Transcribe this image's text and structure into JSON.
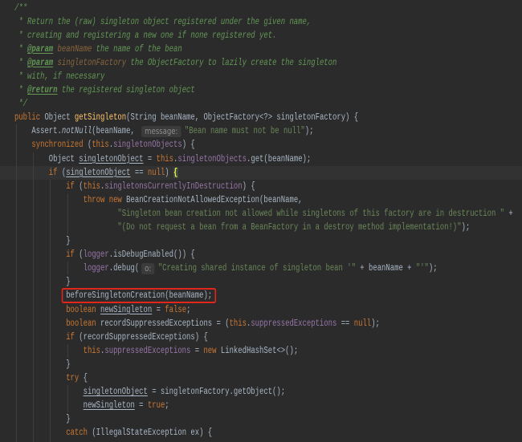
{
  "colors": {
    "background": "#2B2B2B",
    "text": "#A9B7C6",
    "current_line": "#323232",
    "indent_guide": "#3E3E3E",
    "annotation_box": "#E3261C",
    "hint_text": "#8E8E8E",
    "hint_background": "#3B3B3B"
  },
  "editor": {
    "lines": [
      {
        "tokens": [
          {
            "t": "/**",
            "c": "#629755",
            "i": true
          }
        ]
      },
      {
        "tokens": [
          {
            "t": " * Return the (raw) singleton object registered under the given name,",
            "c": "#629755",
            "i": true
          }
        ]
      },
      {
        "tokens": [
          {
            "t": " * creating and registering a new one if none registered yet.",
            "c": "#629755",
            "i": true
          }
        ]
      },
      {
        "tokens": [
          {
            "t": " * ",
            "c": "#629755",
            "i": true
          },
          {
            "t": "@param",
            "c": "#629755",
            "i": true,
            "b": true,
            "u": true
          },
          {
            "t": " ",
            "c": "#629755",
            "i": true
          },
          {
            "t": "beanName",
            "c": "#8A653B",
            "i": true
          },
          {
            "t": " the name of the bean",
            "c": "#629755",
            "i": true
          }
        ]
      },
      {
        "tokens": [
          {
            "t": " * ",
            "c": "#629755",
            "i": true
          },
          {
            "t": "@param",
            "c": "#629755",
            "i": true,
            "b": true,
            "u": true
          },
          {
            "t": " ",
            "c": "#629755",
            "i": true
          },
          {
            "t": "singletonFactory",
            "c": "#8A653B",
            "i": true
          },
          {
            "t": " the ObjectFactory to lazily create the singleton",
            "c": "#629755",
            "i": true
          }
        ]
      },
      {
        "tokens": [
          {
            "t": " * with, if necessary",
            "c": "#629755",
            "i": true
          }
        ]
      },
      {
        "tokens": [
          {
            "t": " * ",
            "c": "#629755",
            "i": true
          },
          {
            "t": "@return",
            "c": "#629755",
            "i": true,
            "b": true,
            "u": true
          },
          {
            "t": " the registered singleton object",
            "c": "#629755",
            "i": true
          }
        ]
      },
      {
        "tokens": [
          {
            "t": " */",
            "c": "#629755",
            "i": true
          }
        ]
      },
      {
        "tokens": [
          {
            "t": "public",
            "c": "#CC7832"
          },
          {
            "t": " Object "
          },
          {
            "t": "getSingleton",
            "c": "#FFC66D"
          },
          {
            "t": "(String beanName, ObjectFactory<?> singletonFactory) {"
          }
        ]
      },
      {
        "tokens": [
          {
            "t": "    Assert."
          },
          {
            "t": "notNull",
            "i": true
          },
          {
            "t": "(beanName, "
          },
          {
            "t": "message:",
            "hint": true
          },
          {
            "t": "\"Bean name must not be null\"",
            "c": "#6A8759"
          },
          {
            "t": ");"
          }
        ]
      },
      {
        "tokens": [
          {
            "t": "    "
          },
          {
            "t": "synchronized",
            "c": "#CC7832"
          },
          {
            "t": " ("
          },
          {
            "t": "this",
            "c": "#CC7832"
          },
          {
            "t": "."
          },
          {
            "t": "singletonObjects",
            "c": "#9876AA"
          },
          {
            "t": ") {"
          }
        ]
      },
      {
        "tokens": [
          {
            "t": "        Object "
          },
          {
            "t": "singletonObject",
            "u": true
          },
          {
            "t": " = "
          },
          {
            "t": "this",
            "c": "#CC7832"
          },
          {
            "t": "."
          },
          {
            "t": "singletonObjects",
            "c": "#9876AA"
          },
          {
            "t": ".get(beanName);"
          }
        ]
      },
      {
        "current": true,
        "tokens": [
          {
            "t": "        "
          },
          {
            "t": "if",
            "c": "#CC7832"
          },
          {
            "t": " ("
          },
          {
            "t": "singletonObject",
            "u": true
          },
          {
            "t": " == "
          },
          {
            "t": "null",
            "c": "#CC7832"
          },
          {
            "t": ") "
          },
          {
            "t": "{",
            "c": "#FFEF28",
            "b": true,
            "bg": "#3B514D"
          }
        ]
      },
      {
        "tokens": [
          {
            "t": "            "
          },
          {
            "t": "if",
            "c": "#CC7832"
          },
          {
            "t": " ("
          },
          {
            "t": "this",
            "c": "#CC7832"
          },
          {
            "t": "."
          },
          {
            "t": "singletonsCurrentlyInDestruction",
            "c": "#9876AA"
          },
          {
            "t": ") {"
          }
        ]
      },
      {
        "tokens": [
          {
            "t": "                "
          },
          {
            "t": "throw",
            "c": "#CC7832"
          },
          {
            "t": " "
          },
          {
            "t": "new",
            "c": "#CC7832"
          },
          {
            "t": " BeanCreationNotAllowedException(beanName,"
          }
        ]
      },
      {
        "tokens": [
          {
            "t": "                        "
          },
          {
            "t": "\"Singleton bean creation not allowed while singletons of this factory are in destruction \"",
            "c": "#6A8759"
          },
          {
            "t": " +"
          }
        ]
      },
      {
        "tokens": [
          {
            "t": "                        "
          },
          {
            "t": "\"(Do not request a bean from a BeanFactory in a destroy method implementation!)\"",
            "c": "#6A8759"
          },
          {
            "t": ");"
          }
        ]
      },
      {
        "tokens": [
          {
            "t": "            }"
          }
        ]
      },
      {
        "tokens": [
          {
            "t": "            "
          },
          {
            "t": "if",
            "c": "#CC7832"
          },
          {
            "t": " ("
          },
          {
            "t": "logger",
            "c": "#9876AA"
          },
          {
            "t": ".isDebugEnabled()) {"
          }
        ]
      },
      {
        "tokens": [
          {
            "t": "                "
          },
          {
            "t": "logger",
            "c": "#9876AA"
          },
          {
            "t": ".debug("
          },
          {
            "t": "o:",
            "hint": true
          },
          {
            "t": "\"Creating shared instance of singleton bean '\"",
            "c": "#6A8759"
          },
          {
            "t": " + beanName + "
          },
          {
            "t": "\"'\"",
            "c": "#6A8759"
          },
          {
            "t": ");"
          }
        ]
      },
      {
        "tokens": [
          {
            "t": "            }"
          }
        ]
      },
      {
        "tokens": [
          {
            "t": "            "
          },
          {
            "t": "beforeSingletonCreation(beanName);",
            "box": true
          }
        ]
      },
      {
        "tokens": [
          {
            "t": "            "
          },
          {
            "t": "boolean",
            "c": "#CC7832"
          },
          {
            "t": " "
          },
          {
            "t": "newSingleton",
            "u": true
          },
          {
            "t": " = "
          },
          {
            "t": "false",
            "c": "#CC7832"
          },
          {
            "t": ";"
          }
        ]
      },
      {
        "tokens": [
          {
            "t": "            "
          },
          {
            "t": "boolean",
            "c": "#CC7832"
          },
          {
            "t": " recordSuppressedExceptions = ("
          },
          {
            "t": "this",
            "c": "#CC7832"
          },
          {
            "t": "."
          },
          {
            "t": "suppressedExceptions",
            "c": "#9876AA"
          },
          {
            "t": " == "
          },
          {
            "t": "null",
            "c": "#CC7832"
          },
          {
            "t": ");"
          }
        ]
      },
      {
        "tokens": [
          {
            "t": "            "
          },
          {
            "t": "if",
            "c": "#CC7832"
          },
          {
            "t": " (recordSuppressedExceptions) {"
          }
        ]
      },
      {
        "tokens": [
          {
            "t": "                "
          },
          {
            "t": "this",
            "c": "#CC7832"
          },
          {
            "t": "."
          },
          {
            "t": "suppressedExceptions",
            "c": "#9876AA"
          },
          {
            "t": " = "
          },
          {
            "t": "new",
            "c": "#CC7832"
          },
          {
            "t": " LinkedHashSet<>();"
          }
        ]
      },
      {
        "tokens": [
          {
            "t": "            }"
          }
        ]
      },
      {
        "tokens": [
          {
            "t": "            "
          },
          {
            "t": "try",
            "c": "#CC7832"
          },
          {
            "t": " {"
          }
        ]
      },
      {
        "tokens": [
          {
            "t": "                "
          },
          {
            "t": "singletonObject",
            "u": true
          },
          {
            "t": " = singletonFactory.getObject();"
          }
        ]
      },
      {
        "tokens": [
          {
            "t": "                "
          },
          {
            "t": "newSingleton",
            "u": true
          },
          {
            "t": " = "
          },
          {
            "t": "true",
            "c": "#CC7832"
          },
          {
            "t": ";"
          }
        ]
      },
      {
        "tokens": [
          {
            "t": "            }"
          }
        ]
      },
      {
        "tokens": [
          {
            "t": "            "
          },
          {
            "t": "catch",
            "c": "#CC7832"
          },
          {
            "t": " (IllegalStateException ex) {"
          }
        ]
      }
    ]
  }
}
